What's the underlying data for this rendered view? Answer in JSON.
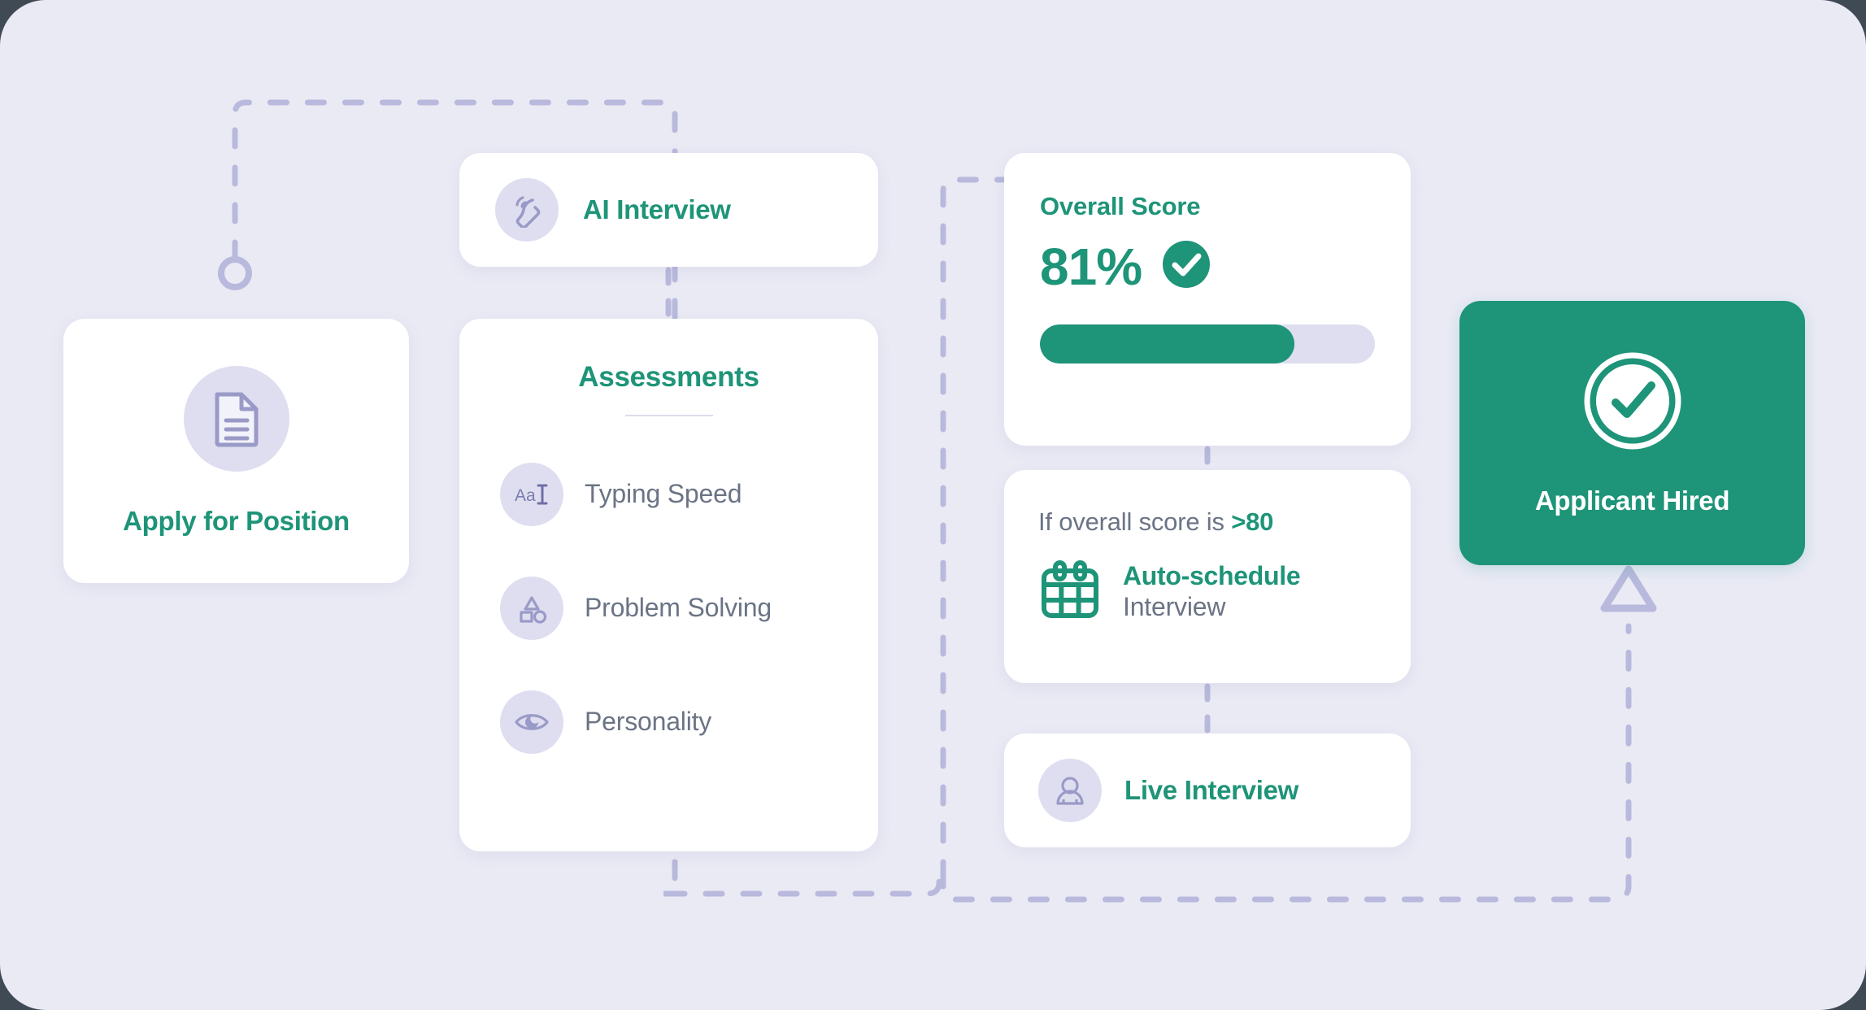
{
  "theme": {
    "background": "#eaeaf5",
    "accent_green": "#1e9478",
    "icon_bubble": "#dedef0",
    "icon_stroke": "#9a9ac8",
    "connector": "#b9b9dd",
    "muted_text": "#6b7485",
    "card_white": "#ffffff"
  },
  "apply": {
    "label": "Apply for Position",
    "icon": "document-icon"
  },
  "ai_interview": {
    "label": "AI Interview",
    "icon": "phone-call-icon"
  },
  "assessments": {
    "title": "Assessments",
    "items": [
      {
        "label": "Typing Speed",
        "icon": "text-cursor-icon"
      },
      {
        "label": "Problem Solving",
        "icon": "shapes-icon"
      },
      {
        "label": "Personality",
        "icon": "eye-icon"
      }
    ]
  },
  "overall_score": {
    "title": "Overall Score",
    "value": "81%",
    "progress_percent": 76,
    "status_icon": "check-circle-icon"
  },
  "auto_schedule": {
    "condition_prefix": "If overall score is ",
    "condition_threshold": ">80",
    "main_label": "Auto-schedule",
    "sub_label": "Interview",
    "icon": "calendar-icon"
  },
  "live_interview": {
    "label": "Live Interview",
    "icon": "person-icon"
  },
  "hired": {
    "label": "Applicant Hired",
    "icon": "check-circle-outline-icon"
  },
  "connectors": {
    "start_node_icon": "circle-node-icon",
    "end_arrow_icon": "triangle-arrow-up-icon"
  }
}
